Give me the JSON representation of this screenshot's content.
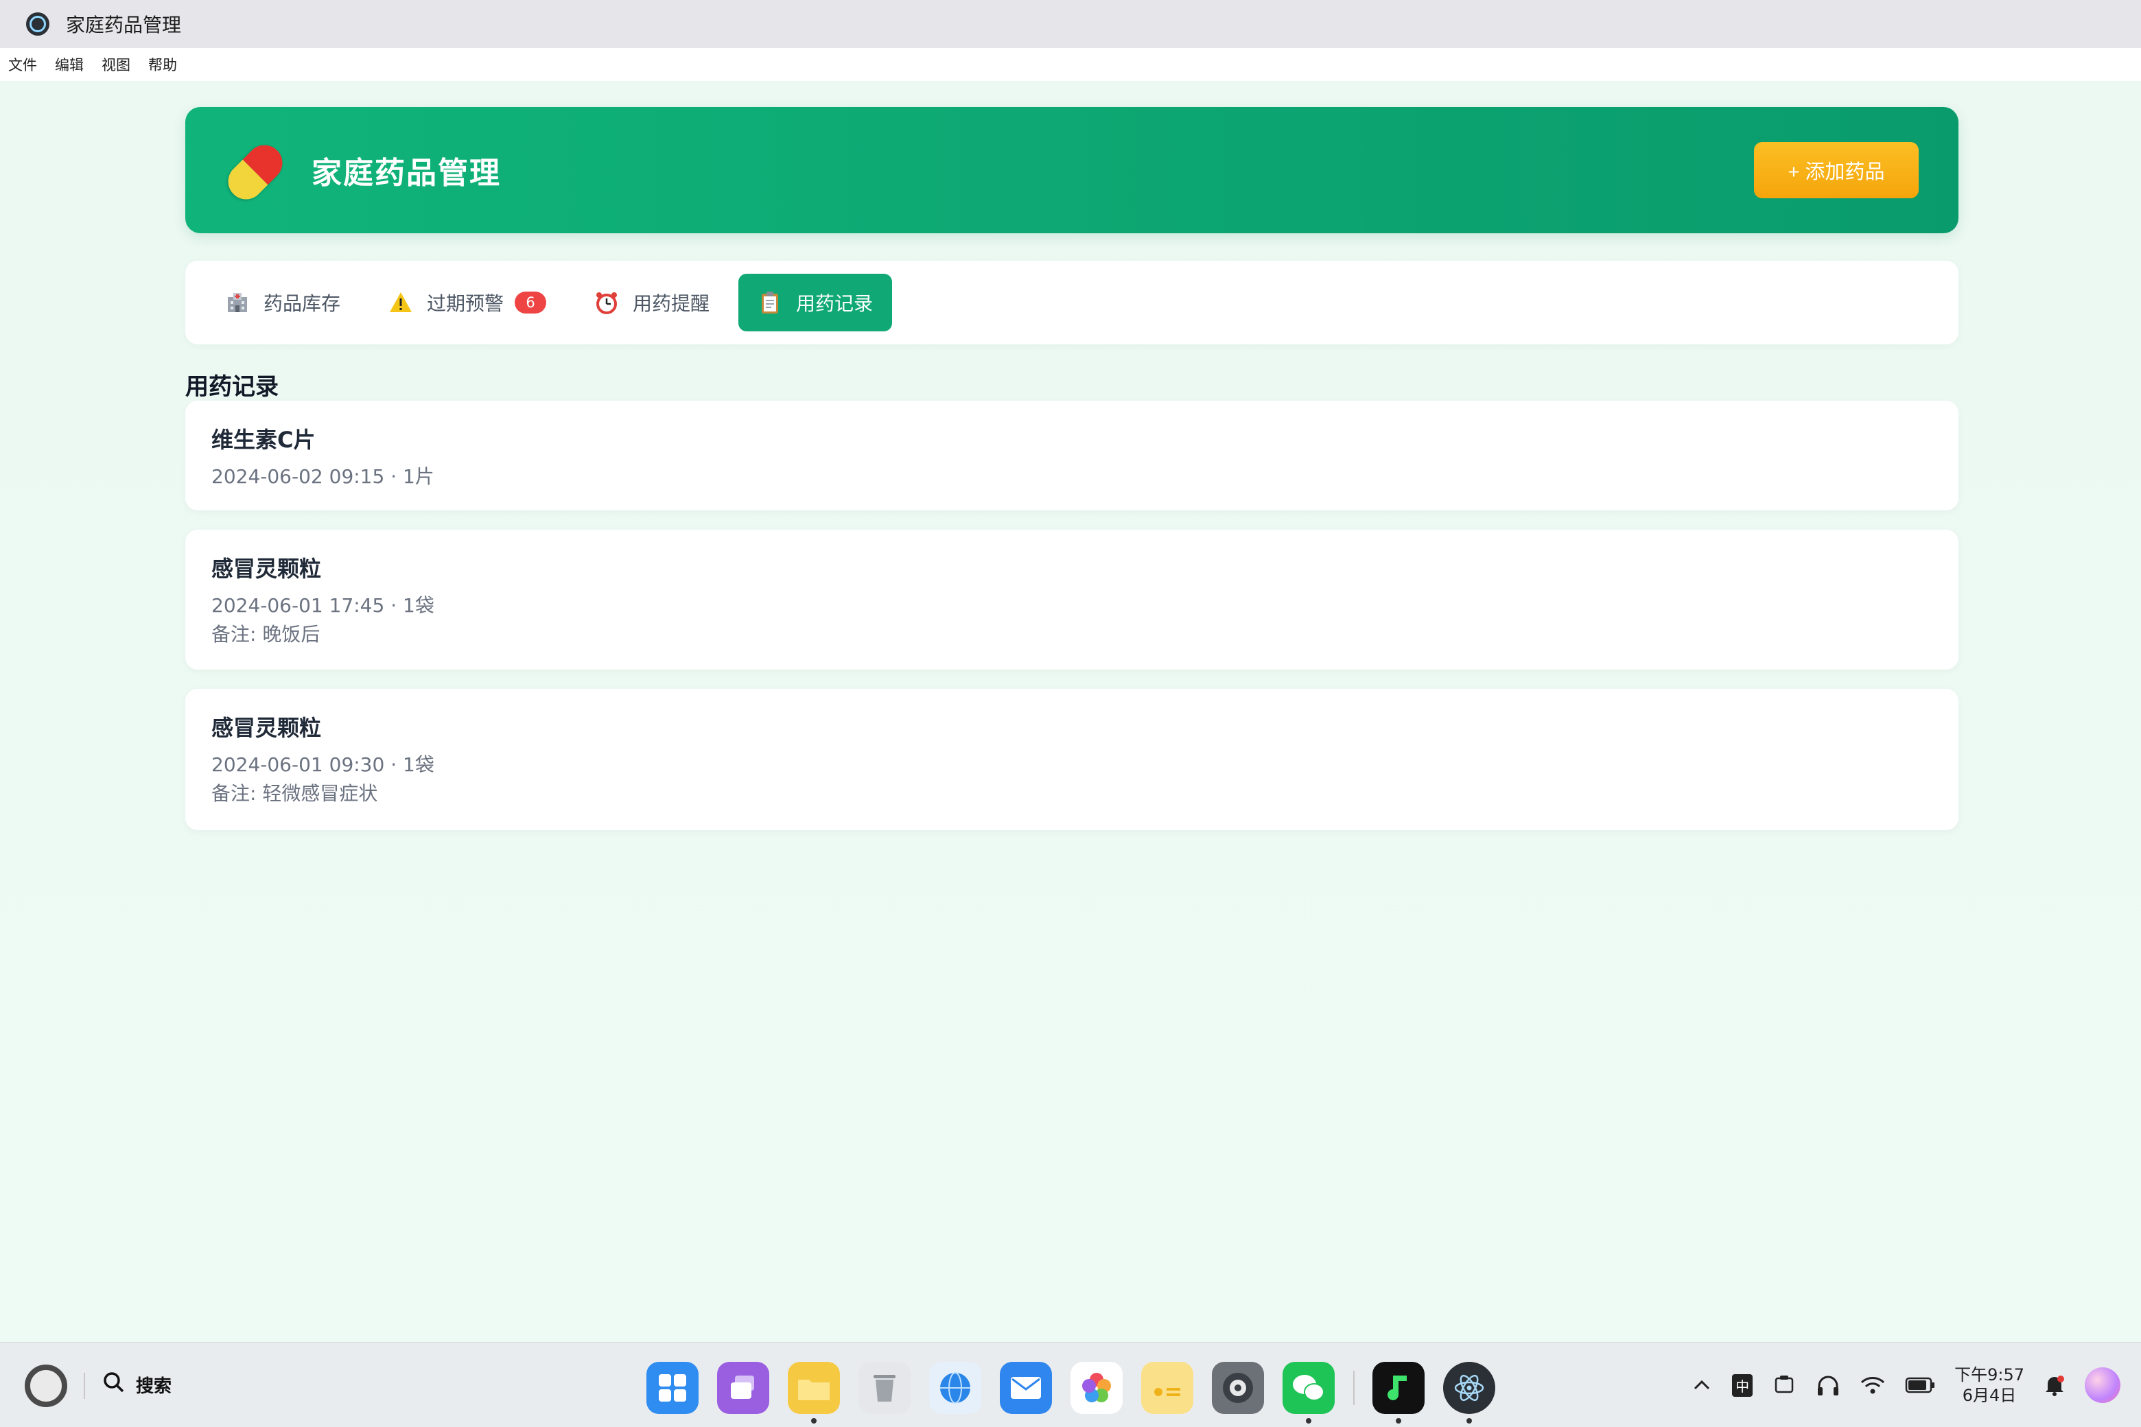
{
  "window": {
    "title": "家庭药品管理"
  },
  "menu": [
    "文件",
    "编辑",
    "视图",
    "帮助"
  ],
  "header": {
    "title": "家庭药品管理",
    "add_button": "+ 添加药品"
  },
  "tabs": [
    {
      "label": "药品库存",
      "icon": "hospital-icon"
    },
    {
      "label": "过期预警",
      "icon": "warning-icon",
      "badge": "6"
    },
    {
      "label": "用药提醒",
      "icon": "alarm-clock-icon"
    },
    {
      "label": "用药记录",
      "icon": "clipboard-icon",
      "active": true
    }
  ],
  "section": {
    "title": "用药记录"
  },
  "records": [
    {
      "name": "维生素C片",
      "meta": "2024-06-02 09:15 · 1片",
      "note": ""
    },
    {
      "name": "感冒灵颗粒",
      "meta": "2024-06-01 17:45 · 1袋",
      "note": "备注: 晚饭后"
    },
    {
      "name": "感冒灵颗粒",
      "meta": "2024-06-01 09:30 · 1袋",
      "note": "备注: 轻微感冒症状"
    }
  ],
  "taskbar": {
    "search_label": "搜索",
    "ime": "中",
    "clock_time": "下午9:57",
    "clock_date": "6月4日"
  },
  "colors": {
    "primary": "#10b47a",
    "accent": "#f5a50b",
    "badge": "#ef4444",
    "background": "#eef8f3"
  }
}
